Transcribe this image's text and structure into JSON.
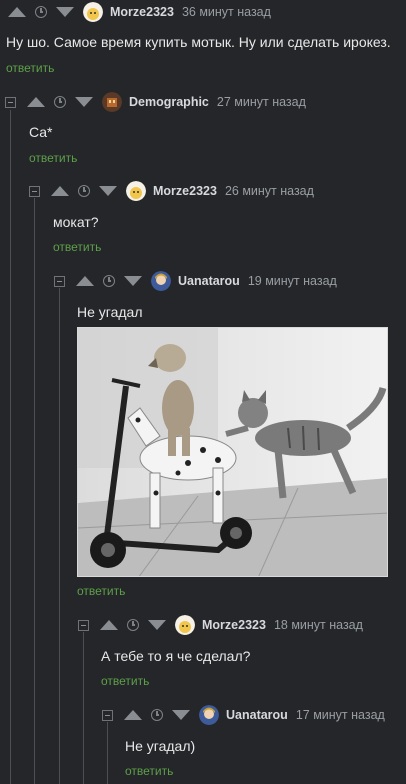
{
  "reply_label": "ответить",
  "comments": [
    {
      "author": "Morze2323",
      "time": "36 минут назад",
      "text": "Ну шо. Самое время купить мотык. Ну или сделать ирокез."
    },
    {
      "author": "Demographic",
      "time": "27 минут назад",
      "text": "Са*"
    },
    {
      "author": "Morze2323",
      "time": "26 минут назад",
      "text": "мокат?"
    },
    {
      "author": "Uanatarou",
      "time": "19 минут назад",
      "text": "Не угадал"
    },
    {
      "author": "Morze2323",
      "time": "18 минут назад",
      "text": "А тебе то я че сделал?"
    },
    {
      "author": "Uanatarou",
      "time": "17 минут назад",
      "text": "Не угадал)"
    }
  ],
  "colors": {
    "background": "#242629",
    "reply": "#5ea04a",
    "thread_line": "#4b4e52"
  }
}
